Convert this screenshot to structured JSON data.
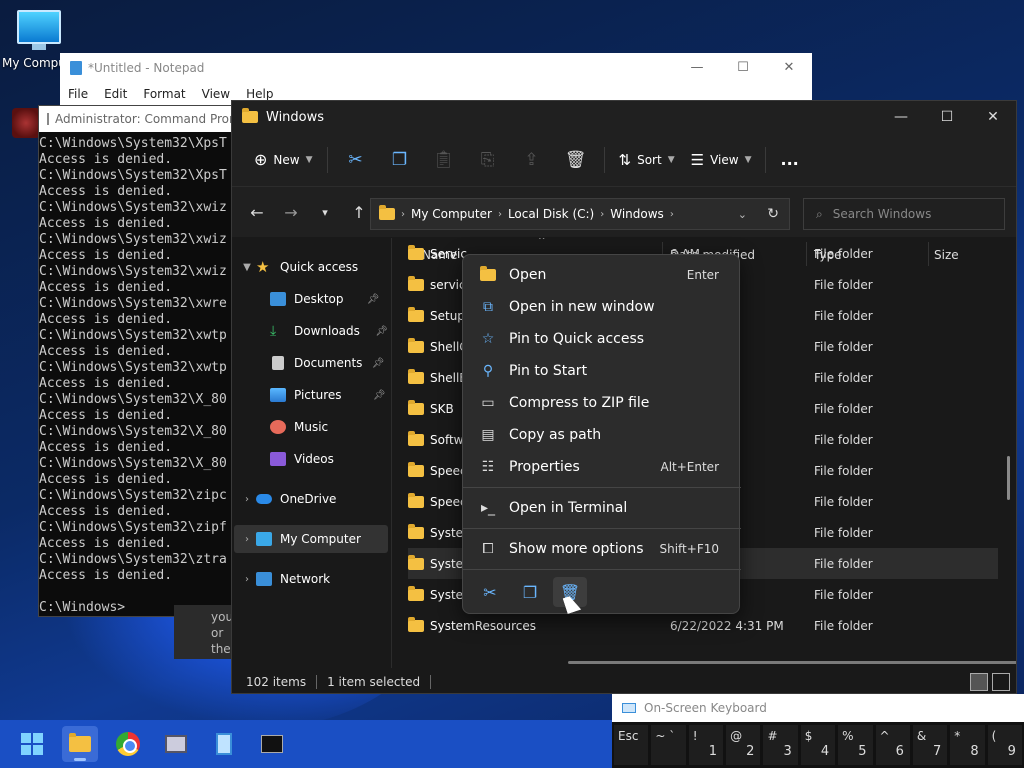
{
  "desktop": {
    "icon_label": "My Computer"
  },
  "notepad": {
    "title": "*Untitled - Notepad",
    "menu": [
      "File",
      "Edit",
      "Format",
      "View",
      "Help"
    ]
  },
  "cmd": {
    "title": "Administrator: Command Prompt",
    "lines": [
      "C:\\Windows\\System32\\XpsT",
      "Access is denied.",
      "C:\\Windows\\System32\\XpsT",
      "Access is denied.",
      "C:\\Windows\\System32\\xwiz",
      "Access is denied.",
      "C:\\Windows\\System32\\xwiz",
      "Access is denied.",
      "C:\\Windows\\System32\\xwiz",
      "Access is denied.",
      "C:\\Windows\\System32\\xwre",
      "Access is denied.",
      "C:\\Windows\\System32\\xwtp",
      "Access is denied.",
      "C:\\Windows\\System32\\xwtp",
      "Access is denied.",
      "C:\\Windows\\System32\\X_80",
      "Access is denied.",
      "C:\\Windows\\System32\\X_80",
      "Access is denied.",
      "C:\\Windows\\System32\\X_80",
      "Access is denied.",
      "C:\\Windows\\System32\\zipc",
      "Access is denied.",
      "C:\\Windows\\System32\\zipf",
      "Access is denied.",
      "C:\\Windows\\System32\\ztra",
      "Access is denied.",
      "",
      "C:\\Windows>"
    ]
  },
  "behind_window": {
    "lines": [
      "you",
      "or",
      "the"
    ]
  },
  "explorer": {
    "title": "Windows",
    "toolbar": {
      "new_label": "New",
      "sort_label": "Sort",
      "view_label": "View",
      "more_label": "..."
    },
    "breadcrumb": [
      "My Computer",
      "Local Disk (C:)",
      "Windows"
    ],
    "search_placeholder": "Search Windows",
    "nav": {
      "quick_access": "Quick access",
      "items": [
        "Desktop",
        "Downloads",
        "Documents",
        "Pictures",
        "Music",
        "Videos"
      ],
      "onedrive": "OneDrive",
      "my_computer": "My Computer",
      "network": "Network"
    },
    "columns": [
      "Name",
      "Date modified",
      "Type",
      "Size"
    ],
    "rows": [
      {
        "name": "Servic",
        "date": "6 AM",
        "type": "File folder"
      },
      {
        "name": "servici",
        "date": "0 PM",
        "type": "File folder"
      },
      {
        "name": "Setup",
        "date": "AM",
        "type": "File folder"
      },
      {
        "name": "ShellC",
        "date": "0 PM",
        "type": "File folder"
      },
      {
        "name": "ShellE",
        "date": "0 PM",
        "type": "File folder"
      },
      {
        "name": "SKB",
        "date": "AM",
        "type": "File folder"
      },
      {
        "name": "Softw",
        "date": "6 PM",
        "type": "File folder"
      },
      {
        "name": "Speec",
        "date": "AM",
        "type": "File folder"
      },
      {
        "name": "Speec",
        "date": "AM",
        "type": "File folder"
      },
      {
        "name": "Syster",
        "date": "AM",
        "type": "File folder"
      },
      {
        "name": "Syster",
        "date": "1 PM",
        "type": "File folder"
      },
      {
        "name": "Syster",
        "date": "AM",
        "type": "File folder"
      },
      {
        "name": "SystemResources",
        "date": "6/22/2022 4:31 PM",
        "type": "File folder"
      }
    ],
    "status": {
      "count": "102 items",
      "selected": "1 item selected"
    }
  },
  "context_menu": {
    "items": [
      {
        "label": "Open",
        "shortcut": "Enter"
      },
      {
        "label": "Open in new window",
        "shortcut": ""
      },
      {
        "label": "Pin to Quick access",
        "shortcut": ""
      },
      {
        "label": "Pin to Start",
        "shortcut": ""
      },
      {
        "label": "Compress to ZIP file",
        "shortcut": ""
      },
      {
        "label": "Copy as path",
        "shortcut": ""
      },
      {
        "label": "Properties",
        "shortcut": "Alt+Enter"
      },
      {
        "label": "Open in Terminal",
        "shortcut": ""
      },
      {
        "label": "Show more options",
        "shortcut": "Shift+F10"
      }
    ]
  },
  "osk": {
    "title": "On-Screen Keyboard",
    "keys": [
      {
        "lo": "Esc",
        "hi": ""
      },
      {
        "lo": "~ `",
        "hi": ""
      },
      {
        "lo": "!",
        "hi": "1"
      },
      {
        "lo": "@",
        "hi": "2"
      },
      {
        "lo": "#",
        "hi": "3"
      },
      {
        "lo": "$",
        "hi": "4"
      },
      {
        "lo": "%",
        "hi": "5"
      },
      {
        "lo": "^",
        "hi": "6"
      },
      {
        "lo": "&",
        "hi": "7"
      },
      {
        "lo": "*",
        "hi": "8"
      },
      {
        "lo": "(",
        "hi": "9"
      }
    ]
  },
  "colors": {
    "accent": "#6ab7ff",
    "folder": "#f4c042",
    "taskbar": "#1a4fc4"
  }
}
